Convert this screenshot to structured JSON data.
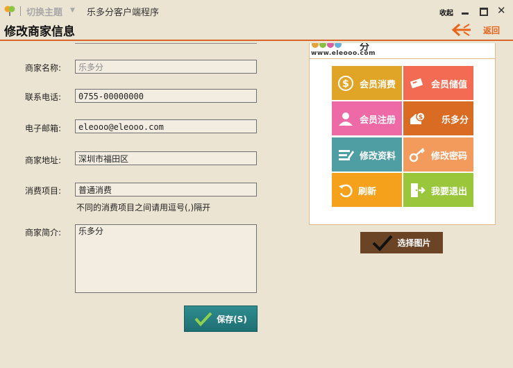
{
  "titlebar": {
    "theme_label": "切换主题",
    "app_title": "乐多分客户端程序",
    "collapse_label": "收起"
  },
  "header": {
    "title": "修改商家信息",
    "back_label": "返回"
  },
  "form": {
    "name_label": "商家名称:",
    "name_value": "乐多分",
    "phone_label": "联系电话:",
    "phone_value": "0755-00000000",
    "email_label": "电子邮箱:",
    "email_value": "eleooo@eleooo.com",
    "address_label": "商家地址:",
    "address_value": "深圳市福田区",
    "items_label": "消费项目:",
    "items_value": "普通消费",
    "items_hint": "不同的消费项目之间请用逗号(,)隔开",
    "intro_label": "商家简介:",
    "intro_value": "乐多分",
    "save_label": "保存(S)"
  },
  "preview": {
    "logo_text": "www.eleooo.com",
    "tiles": [
      {
        "label": "会员消费",
        "color": "#e0a526",
        "icon": "dollar-icon"
      },
      {
        "label": "会员储值",
        "color": "#f26b52",
        "icon": "card-icon"
      },
      {
        "label": "会员注册",
        "color": "#ee6aa7",
        "icon": "user-icon"
      },
      {
        "label": "乐多分",
        "color": "#d96b22",
        "icon": "house-dollar-icon"
      },
      {
        "label": "修改资料",
        "color": "#4f9ea3",
        "icon": "edit-icon"
      },
      {
        "label": "修改密码",
        "color": "#f39a5d",
        "icon": "key-icon"
      },
      {
        "label": "刷新",
        "color": "#f5a11b",
        "icon": "refresh-icon"
      },
      {
        "label": "我要退出",
        "color": "#99c63a",
        "icon": "exit-icon"
      }
    ],
    "select_label": "选择图片"
  },
  "colors": {
    "accent": "#d9652b",
    "background": "#ece4d2",
    "save_button": "#2f8c8f",
    "select_button": "#6b4426"
  }
}
